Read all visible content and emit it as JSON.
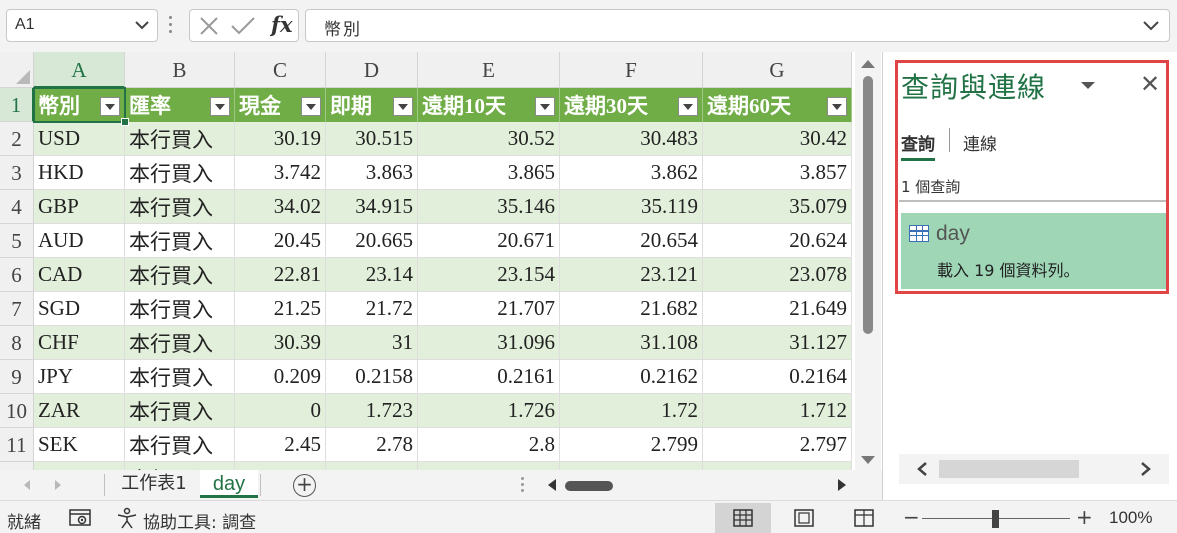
{
  "formula_bar": {
    "name_box": "A1",
    "fx_label": "fx",
    "content": "幣別"
  },
  "columns": [
    "A",
    "B",
    "C",
    "D",
    "E",
    "F",
    "G"
  ],
  "rows": [
    "1",
    "2",
    "3",
    "4",
    "5",
    "6",
    "7",
    "8",
    "9",
    "10",
    "11"
  ],
  "table": {
    "headers": [
      "幣別",
      "匯率",
      "現金",
      "即期",
      "遠期10天",
      "遠期30天",
      "遠期60天"
    ],
    "data": [
      [
        "USD",
        "本行買入",
        "30.19",
        "30.515",
        "30.52",
        "30.483",
        "30.42"
      ],
      [
        "HKD",
        "本行買入",
        "3.742",
        "3.863",
        "3.865",
        "3.862",
        "3.857"
      ],
      [
        "GBP",
        "本行買入",
        "34.02",
        "34.915",
        "35.146",
        "35.119",
        "35.079"
      ],
      [
        "AUD",
        "本行買入",
        "20.45",
        "20.665",
        "20.671",
        "20.654",
        "20.624"
      ],
      [
        "CAD",
        "本行買入",
        "22.81",
        "23.14",
        "23.154",
        "23.121",
        "23.078"
      ],
      [
        "SGD",
        "本行買入",
        "21.25",
        "21.72",
        "21.707",
        "21.682",
        "21.649"
      ],
      [
        "CHF",
        "本行買入",
        "30.39",
        "31",
        "31.096",
        "31.108",
        "31.127"
      ],
      [
        "JPY",
        "本行買入",
        "0.209",
        "0.2158",
        "0.2161",
        "0.2162",
        "0.2164"
      ],
      [
        "ZAR",
        "本行買入",
        "0",
        "1.723",
        "1.726",
        "1.72",
        "1.712"
      ],
      [
        "SEK",
        "本行買入",
        "2.45",
        "2.78",
        "2.8",
        "2.799",
        "2.797"
      ]
    ],
    "partial_row": [
      "",
      "本行買入",
      "",
      "",
      "",
      "",
      ""
    ]
  },
  "sheet_tabs": [
    {
      "label": "工作表1",
      "active": false
    },
    {
      "label": "day",
      "active": true
    }
  ],
  "query_pane": {
    "title": "查詢與連線",
    "tabs": [
      "查詢",
      "連線"
    ],
    "active_tab": "查詢",
    "count_text": "1 個查詢",
    "items": [
      {
        "name": "day",
        "description": "載入 19 個資料列。"
      }
    ]
  },
  "status_bar": {
    "ready": "就緒",
    "accessibility": "協助工具: 調查",
    "zoom": "100%"
  },
  "colors": {
    "accent": "#217346",
    "table_header": "#70ad47",
    "band": "#e2efda",
    "query_item": "#9ed6b6",
    "highlight": "#e04444"
  },
  "icons": [
    "chevron-down-icon",
    "cancel-icon",
    "enter-icon",
    "fx-icon",
    "filter-icon",
    "add-sheet-icon",
    "close-icon",
    "table-icon",
    "macro-record-icon",
    "accessibility-icon",
    "normal-view-icon",
    "page-layout-icon",
    "page-break-icon"
  ]
}
